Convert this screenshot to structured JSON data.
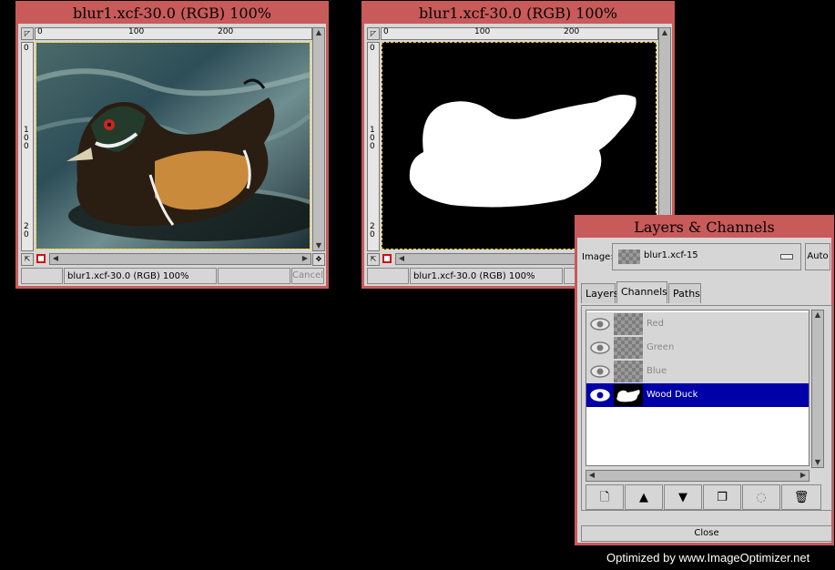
{
  "window1": {
    "title": "blur1.xcf-30.0 (RGB) 100%",
    "ruler_h": [
      "0",
      "100",
      "200"
    ],
    "ruler_v": [
      "0",
      "1",
      "0",
      "0",
      "2",
      "0"
    ],
    "status": "blur1.xcf-30.0 (RGB) 100%",
    "cancel_label": "Cancel"
  },
  "window2": {
    "title": "blur1.xcf-30.0 (RGB) 100%",
    "ruler_h": [
      "0",
      "100",
      "200"
    ],
    "ruler_v": [
      "0",
      "1",
      "0",
      "0",
      "2",
      "0"
    ],
    "status": "blur1.xcf-30.0 (RGB) 100%"
  },
  "layers_dialog": {
    "title": "Layers & Channels",
    "image_label": "Image:",
    "image_value": "blur1.xcf-15",
    "auto_label": "Auto",
    "tabs": [
      "Layers",
      "Channels",
      "Paths"
    ],
    "channels": [
      {
        "label": "Red",
        "selected": false
      },
      {
        "label": "Green",
        "selected": false
      },
      {
        "label": "Blue",
        "selected": false
      },
      {
        "label": "Wood Duck",
        "selected": true
      }
    ],
    "close_label": "Close",
    "toolbar_icons": [
      "new-channel-icon",
      "raise-icon",
      "lower-icon",
      "duplicate-icon",
      "channel-to-selection-icon",
      "delete-icon"
    ]
  },
  "watermark": "Optimized by www.ImageOptimizer.net",
  "colors": {
    "title_bar": "#c95a5a",
    "selection": "#0000a8",
    "panel": "#d6d6d6"
  }
}
